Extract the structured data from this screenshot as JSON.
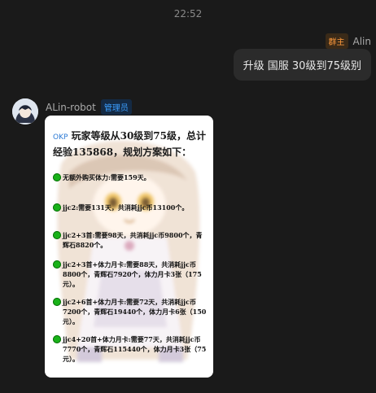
{
  "timestamp": "22:52",
  "sent": {
    "sender_name": "Alin",
    "role_badge": "群主",
    "message": "升级 国服 30级到75级别"
  },
  "received": {
    "sender_name": "ALin-robot",
    "role_badge": "管理员",
    "image_tag": "OKP",
    "image_title": "玩家等级从30级到75级，总计经验135868，规划方案如下：",
    "plans": [
      "无额外购买体力:需要159天。",
      "jjc2:需要131天，共消耗jjc币13100个。",
      "jjc2+3首:需要98天，共消耗jjc币9800个，青辉石8820个。",
      "jjc2+3首+体力月卡:需要88天，共消耗jjc币8800个，青辉石7920个，体力月卡3张（175元）。",
      "jjc2+6首+体力月卡:需要72天，共消耗jjc币7200个，青辉石19440个，体力月卡6张（150元）。",
      "jjc4+20首+体力月卡:需要77天，共消耗jjc币7770个，青辉石115440个，体力月卡3张（75元）。"
    ]
  }
}
